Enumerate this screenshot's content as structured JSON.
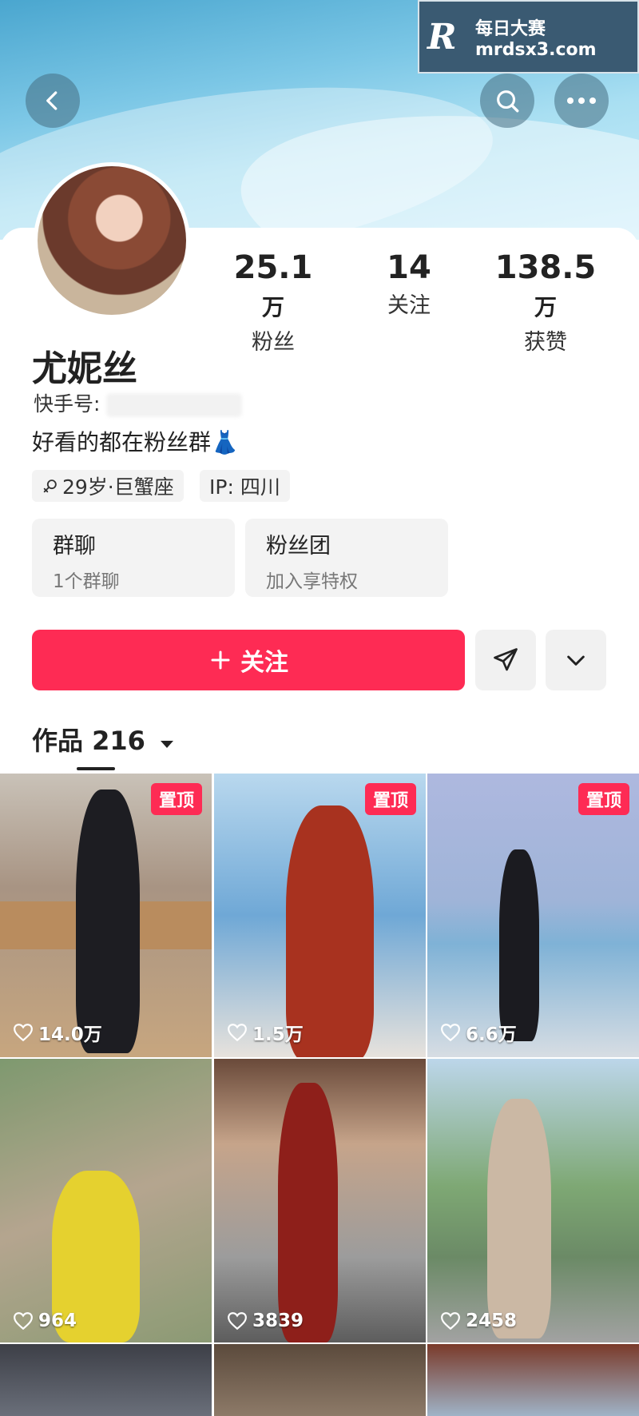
{
  "watermark": {
    "cn": "每日大赛",
    "url": "mrdsx3.com",
    "logo": "R",
    "logo_sub": "每日大赛"
  },
  "profile": {
    "name": "尤妮丝",
    "kuaishou_label": "快手号:",
    "bio": "好看的都在粉丝群👗",
    "tags": [
      "29岁·巨蟹座",
      "IP: 四川"
    ],
    "stats": [
      {
        "num": "25.1",
        "unit": "万",
        "label": "粉丝"
      },
      {
        "num": "14",
        "unit": "",
        "label": "关注"
      },
      {
        "num": "138.5",
        "unit": "万",
        "label": "获赞"
      }
    ],
    "features": [
      {
        "title": "群聊",
        "sub": "1个群聊"
      },
      {
        "title": "粉丝团",
        "sub": "加入享特权"
      }
    ],
    "follow_label": "关注",
    "works_label": "作品 216"
  },
  "grid": {
    "pin_label": "置顶",
    "tiles": [
      {
        "likes": "14.0万",
        "pinned": true
      },
      {
        "likes": "1.5万",
        "pinned": true
      },
      {
        "likes": "6.6万",
        "pinned": true
      },
      {
        "likes": "964",
        "pinned": false
      },
      {
        "likes": "3839",
        "pinned": false
      },
      {
        "likes": "2458",
        "pinned": false
      }
    ]
  },
  "colors": {
    "accent": "#fe2b54",
    "header": "#7cc7e6"
  }
}
